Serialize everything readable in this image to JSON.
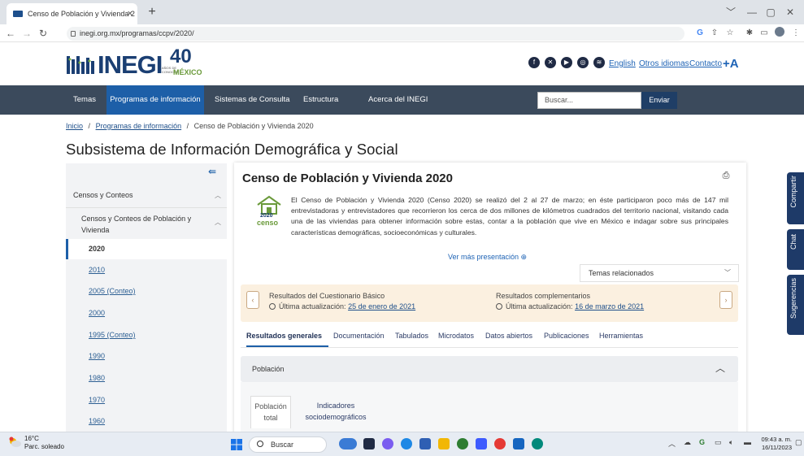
{
  "browser": {
    "tab_title": "Censo de Población y Vivienda 2",
    "tab_close": "×",
    "new_tab": "+",
    "url": "inegi.org.mx/programas/ccpv/2020/",
    "window_controls": [
      "﹀",
      "—",
      "▢",
      "✕"
    ],
    "nav_icons": [
      "back-icon",
      "forward-icon",
      "reload-icon"
    ],
    "toolbar_icons": [
      "google-icon",
      "share-icon",
      "star-icon",
      "extensions-icon",
      "sidepanel-icon",
      "profile-icon",
      "menu-icon"
    ]
  },
  "header": {
    "logo_text": "INEGI",
    "anniv_number": "40",
    "anniv_caption": "AÑOS DE CONOCER",
    "anniv_country": "MÉXICO",
    "social_icons": [
      "facebook-icon",
      "x-icon",
      "youtube-icon",
      "instagram-icon",
      "rss-icon"
    ],
    "links": {
      "english": "English",
      "otros": "Otros idiomas",
      "contacto": "Contacto"
    },
    "aplus": "+A"
  },
  "nav": {
    "items": [
      "Temas",
      "Programas de información",
      "Sistemas de Consulta",
      "Estructura",
      "Acerca del INEGI"
    ],
    "search_placeholder": "Buscar...",
    "search_button": "Enviar"
  },
  "breadcrumb": {
    "inicio": "Inicio",
    "sep": "/",
    "programas": "Programas de información",
    "current": "Censo de Población y Vivienda 2020"
  },
  "page_title": "Subsistema de Información Demográfica y Social",
  "sidebar": {
    "section": "Censos y Conteos",
    "subsection_line1": "Censos y Conteos de Población y",
    "subsection_line2": "Vivienda",
    "active_year": "2020",
    "years": [
      "2010",
      "2005 (Conteo)",
      "2000",
      "1995 (Conteo)",
      "1990",
      "1980",
      "1970",
      "1960"
    ]
  },
  "main": {
    "title": "Censo de Población y Vivienda 2020",
    "logo_year": "2020",
    "logo_word": "censo",
    "description": "El Censo de Población y Vivienda 2020 (Censo 2020) se realizó del 2 al 27 de marzo; en éste participaron poco más de 147 mil entrevistadoras y entrevistadores que recorrieron los cerca de dos millones de kilómetros cuadrados del territorio nacional, visitando cada una de las viviendas para obtener información sobre estas, contar a la población que vive en México e indagar sobre sus principales características demográficas, socioeconómicas y culturales.",
    "ver_mas": "Ver más presentación ⊕",
    "temas_relacionados": "Temas relacionados",
    "results": {
      "basic_title": "Resultados del Cuestionario Básico",
      "basic_update_label": "Última actualización:",
      "basic_update_date": "25 de enero de 2021",
      "comp_title": "Resultados complementarios",
      "comp_update_label": "Última actualización:",
      "comp_update_date": "16 de marzo de 2021"
    },
    "tabs": [
      "Resultados generales",
      "Documentación",
      "Tabulados",
      "Microdatos",
      "Datos abiertos",
      "Publicaciones",
      "Herramientas"
    ],
    "poblacion": {
      "label": "Población",
      "subtab1_line1": "Población",
      "subtab1_line2": "total",
      "subtab2_line1": "Indicadores",
      "subtab2_line2": "sociodemográficos"
    }
  },
  "side_widgets": [
    "Compartir",
    "Chat",
    "Sugerencias"
  ],
  "taskbar": {
    "temperature": "16°C",
    "weather": "Parc. soleado",
    "search": "Buscar",
    "time": "09:43 a. m.",
    "date": "16/11/2023"
  },
  "colors": {
    "nav_bg": "#3b4a5c",
    "nav_active": "#1d5fa8",
    "brand": "#1b3f73",
    "results_bg": "#fbf0e0",
    "anniv_green": "#6a9a3a"
  }
}
